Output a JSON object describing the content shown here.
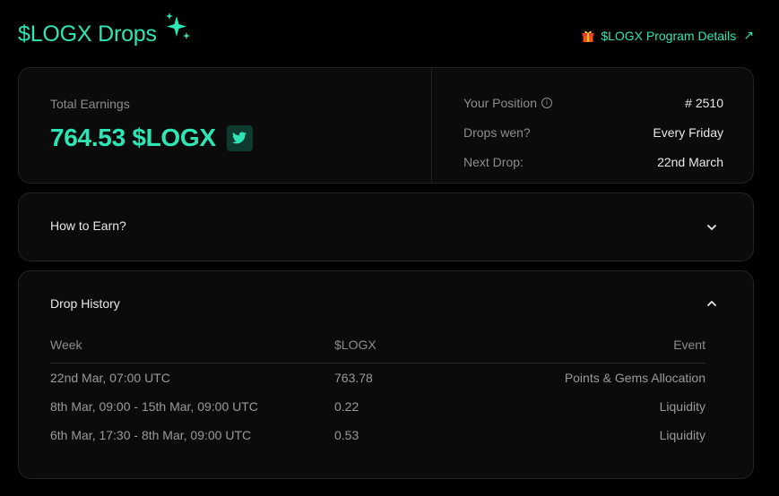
{
  "header": {
    "title": "$LOGX Drops",
    "program_link": "$LOGX Program Details",
    "program_link_arrow": "↗"
  },
  "summary": {
    "total_label": "Total Earnings",
    "total_value": "764.53 $LOGX",
    "stats": [
      {
        "label": "Your Position",
        "value": "# 2510"
      },
      {
        "label": "Drops wen?",
        "value": "Every Friday"
      },
      {
        "label": "Next Drop:",
        "value": "22nd March"
      }
    ]
  },
  "how_to_earn": {
    "title": "How to Earn?"
  },
  "drop_history": {
    "title": "Drop History",
    "columns": [
      "Week",
      "$LOGX",
      "Event"
    ],
    "rows": [
      {
        "week": "22nd Mar, 07:00 UTC",
        "amount": "763.78",
        "event": "Points & Gems Allocation"
      },
      {
        "week": "8th Mar, 09:00 - 15th Mar, 09:00 UTC",
        "amount": "0.22",
        "event": "Liquidity"
      },
      {
        "week": "6th Mar, 17:30 - 8th Mar, 09:00 UTC",
        "amount": "0.53",
        "event": "Liquidity"
      }
    ]
  },
  "colors": {
    "accent": "#2ee6b5",
    "background": "#000000",
    "card": "#0b0b0b",
    "muted_text": "#8d8d8d"
  },
  "icons": [
    "sparkle-icon",
    "gift-icon",
    "external-arrow-icon",
    "twitter-icon",
    "info-icon",
    "chevron-down-icon",
    "chevron-up-icon"
  ]
}
